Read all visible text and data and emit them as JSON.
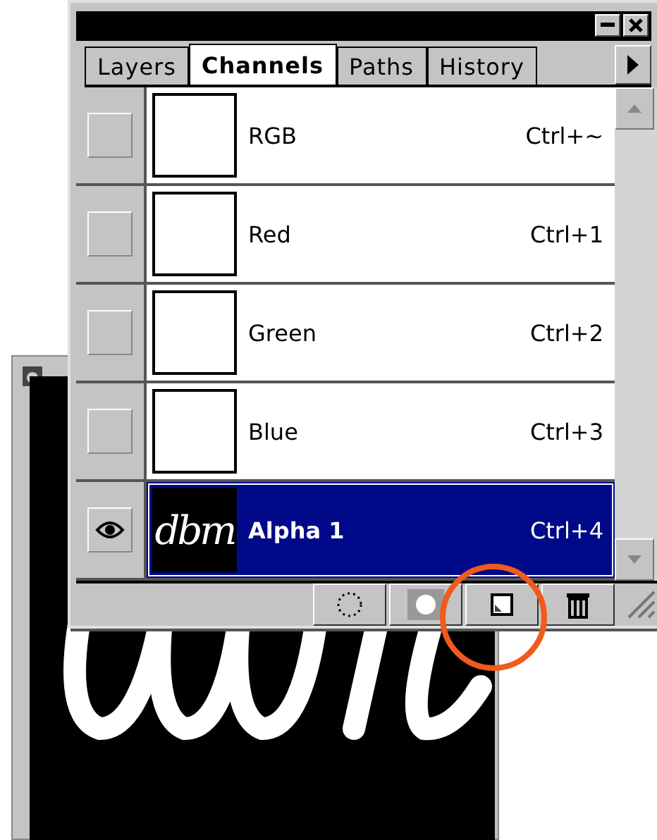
{
  "panel": {
    "tabs": [
      {
        "label": "Layers",
        "selected": false
      },
      {
        "label": "Channels",
        "selected": true
      },
      {
        "label": "Paths",
        "selected": false
      },
      {
        "label": "History",
        "selected": false
      }
    ],
    "channels": [
      {
        "name": "RGB",
        "shortcut": "Ctrl+~",
        "visible": false,
        "selected": false
      },
      {
        "name": "Red",
        "shortcut": "Ctrl+1",
        "visible": false,
        "selected": false
      },
      {
        "name": "Green",
        "shortcut": "Ctrl+2",
        "visible": false,
        "selected": false
      },
      {
        "name": "Blue",
        "shortcut": "Ctrl+3",
        "visible": false,
        "selected": false
      },
      {
        "name": "Alpha 1",
        "shortcut": "Ctrl+4",
        "visible": true,
        "selected": true,
        "thumbnail_text": "dbm"
      }
    ]
  }
}
